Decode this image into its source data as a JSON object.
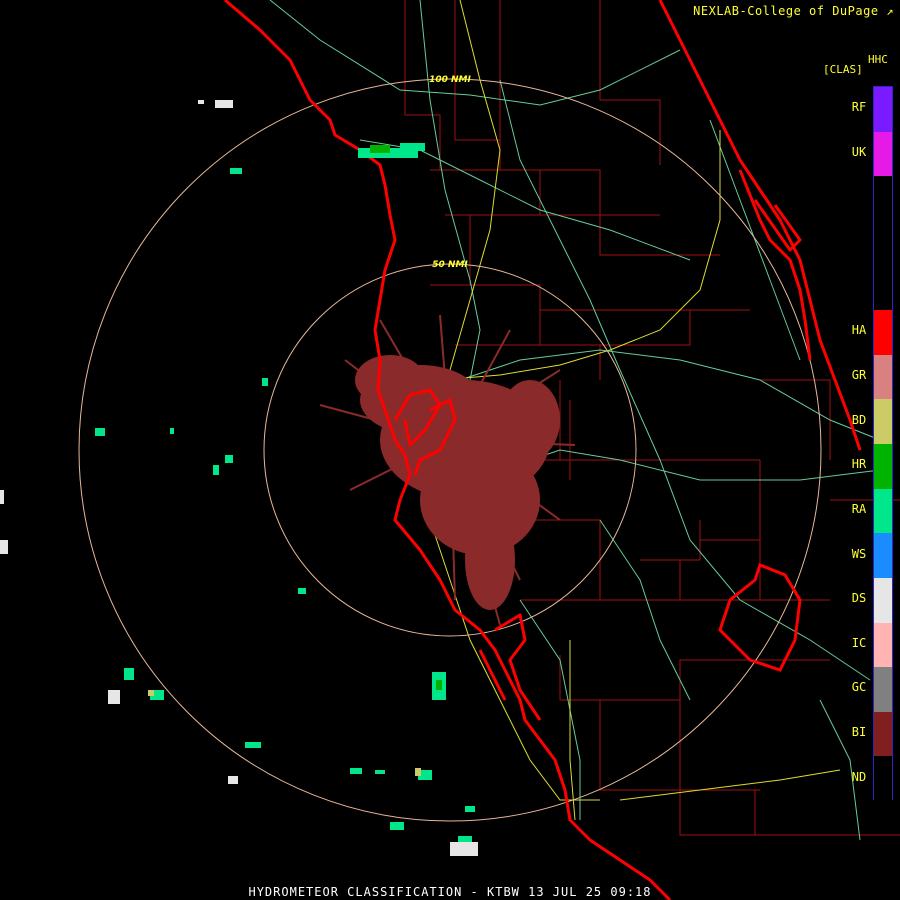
{
  "header": {
    "credit": "NEXLAB-College of DuPage ↗",
    "product_code": "HHC",
    "product_short": "[CLAS]"
  },
  "footer": {
    "title": "HYDROMETEOR CLASSIFICATION - KTBW 13 JUL 25 09:18"
  },
  "range_rings": {
    "inner_label": "50 NMI",
    "outer_label": "100 NMI"
  },
  "legend": {
    "items": [
      {
        "code": "RF",
        "color": "#7a1aff"
      },
      {
        "code": "UK",
        "color": "#e61ae6"
      },
      {
        "code": "",
        "color": "#000000"
      },
      {
        "code": "HA",
        "color": "#ff0000"
      },
      {
        "code": "GR",
        "color": "#d98080"
      },
      {
        "code": "BD",
        "color": "#cccc66"
      },
      {
        "code": "HR",
        "color": "#00b300"
      },
      {
        "code": "RA",
        "color": "#00e68a"
      },
      {
        "code": "WS",
        "color": "#1a8cff"
      },
      {
        "code": "DS",
        "color": "#e6e6e6"
      },
      {
        "code": "IC",
        "color": "#ffb3b3"
      },
      {
        "code": "GC",
        "color": "#808080"
      },
      {
        "code": "BI",
        "color": "#801f1f"
      },
      {
        "code": "ND",
        "color": "#000000"
      }
    ]
  },
  "colors": {
    "coastline": "#ff0000",
    "county_lines": "#a01010",
    "highways_minor": "#66cc99",
    "highways_major": "#dddd33",
    "range_ring": "#e6b89a",
    "biological_echo": "#8a2a2a",
    "rain_echo": "#00e68a"
  }
}
